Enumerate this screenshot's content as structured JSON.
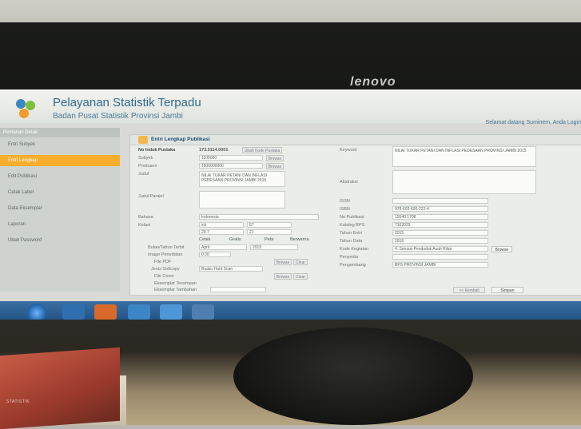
{
  "monitor": {
    "brand": "lenovo"
  },
  "book": {
    "text": "STATISTIK"
  },
  "header": {
    "title": "Pelayanan Statistik Terpadu",
    "subtitle": "Badan Pusat Statistik Provinsi Jambi",
    "welcome": "Selamat datang Suminem, Anda Login"
  },
  "sidebar": {
    "title": "Pemanan Detail",
    "items": [
      {
        "label": "Entri Subyek"
      },
      {
        "label": "Entri Lengkap"
      },
      {
        "label": "Edit Publikasi"
      },
      {
        "label": "Cetak Label"
      },
      {
        "label": "Data Eksemplar"
      },
      {
        "label": "Laporan"
      },
      {
        "label": "Ubah Password"
      }
    ]
  },
  "panel": {
    "title": "Entri Lengkap Publikasi",
    "no_induk_label": "No Induk Pustaka",
    "no_induk_value": "173.0114.0001",
    "no_induk_btn": "Ubah Kode Pustaka",
    "subyek_label": "Subyek",
    "subyek_value": "1105000",
    "produsen_label": "Produsen",
    "produsen_value": "1500000000",
    "browse": "Browse",
    "judul_label": "Judul",
    "judul_value": "NILAI TUKAR PETANI DAN INFLASI PEDESAAN PROVINSI JAMBI 2015",
    "judul_paralel_label": "Judul Paralel",
    "bahasa_label": "Bahasa",
    "bahasa_value": "Indonesia",
    "kolasi_label": "Kolasi",
    "kolasi_a": "xiii",
    "kolasi_b": "67",
    "kolasi_c": "29.7",
    "kolasi_d": "21",
    "chk1": "Cetak",
    "chk2": "Gratis",
    "chk3": "Peta",
    "chk4": "Berwarna",
    "bulan_tahun_label": "Bulan/Tahun Terbit",
    "bulan_value": "April",
    "tahun_value": "2015",
    "image_label": "Image Penerbitan",
    "image_value": "0.00",
    "file_label": "File PDF",
    "jenis_label": "Jenis Softcopy",
    "jenis_value": "Buaku Hard Scan",
    "file_cover_label": "File Cover",
    "file_btn": "Browse",
    "clear_btn": "Clear",
    "eksemplar_label": "Eksemplar Tersimpan",
    "eksemplar_tambah_label": "Eksemplar Tambahan",
    "keyword_label": "Keyword",
    "keyword_value": "NILAI TUKAR PETANI DAN INFLASI PEDESAAN PROVINSI JAMBI 2015",
    "abstraksi_label": "Abstraksi",
    "issn_label": "ISSN",
    "isbn_label": "ISBN",
    "isbn_value": "978-602-690-222-4",
    "no_publikasi_label": "No Publikasi",
    "no_publikasi_value": "15540.1708",
    "katalog_label": "Katalog BPS",
    "katalog_value": "7102029",
    "tahun_data_label": "Tahun Data",
    "tahun_data_value": "2016",
    "tahun_entry_label": "Tahun Entri",
    "tahun_entry_value": "2015",
    "kode_kegiatan_label": "Kode Kegiatan",
    "kode_kegiatan_value": "4. Sensus Penduduk Asah Rilan",
    "penyedia_label": "Penyedia",
    "pengembang_label": "Pengembang",
    "pengembang_value": "BPS PROVINSI JAMBI",
    "cancel_btn": "<< Kembali",
    "save_btn": "Simpan"
  },
  "taskbar": {
    "items": [
      "start",
      "folder",
      "media",
      "office",
      "paint",
      "browser",
      "charts"
    ]
  },
  "colors": {
    "accent": "#f6ad2c",
    "title": "#2f6a8f",
    "taskbar": "#1e4d7d"
  }
}
